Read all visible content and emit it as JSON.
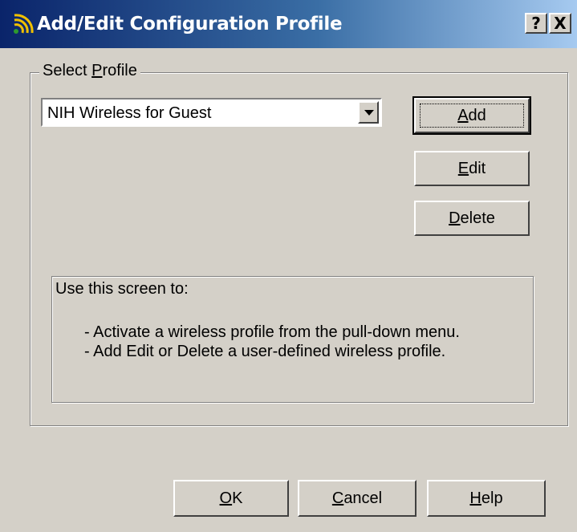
{
  "window": {
    "title": "Add/Edit Configuration Profile",
    "icon": "wireless-signal-icon",
    "help_caption": "?",
    "close_caption": "X"
  },
  "group": {
    "label_prefix": "Select ",
    "label_accel": "P",
    "label_suffix": "rofile"
  },
  "profile_select": {
    "value": "NIH Wireless for Guest"
  },
  "buttons": {
    "add": {
      "accel": "A",
      "rest": "dd"
    },
    "edit": {
      "accel": "E",
      "rest": "dit"
    },
    "delete": {
      "accel": "D",
      "rest": "elete"
    },
    "ok": {
      "accel": "O",
      "rest": "K"
    },
    "cancel": {
      "accel": "C",
      "rest": "ancel"
    },
    "help": {
      "accel": "H",
      "rest": "elp"
    }
  },
  "info": {
    "title": "Use this screen to:",
    "lines": [
      "- Activate a wireless profile from the pull-down menu.",
      "- Add Edit or Delete a user-defined wireless profile."
    ]
  }
}
